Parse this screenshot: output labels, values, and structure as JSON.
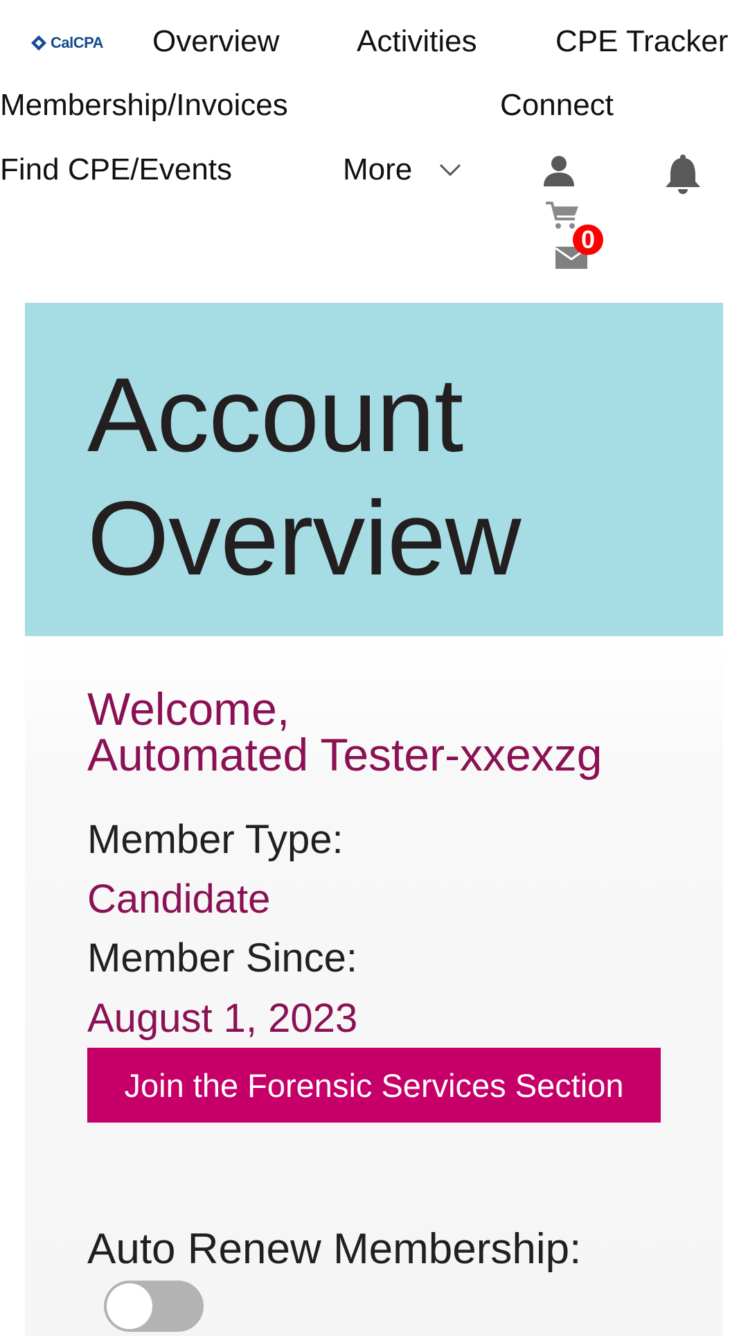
{
  "header": {
    "logo_text": "CalCPA",
    "nav": {
      "overview": "Overview",
      "activities": "Activities",
      "cpe_tracker": "CPE Tracker",
      "membership_invoices": "Membership/Invoices",
      "connect": "Connect",
      "find_cpe_events": "Find CPE/Events",
      "more": "More"
    },
    "icons": [
      "user-icon",
      "bell-icon",
      "cart-icon",
      "mail-icon",
      "chevron-down-icon"
    ],
    "cart_count": "0"
  },
  "hero": {
    "title": "Account Overview"
  },
  "account": {
    "welcome_line1": "Welcome,",
    "welcome_line2": "Automated Tester-xxexzg",
    "member_type_label": "Member Type:",
    "member_type_value": "Candidate",
    "member_since_label": "Member Since:",
    "member_since_value": "August 1, 2023",
    "join_button": "Join the Forensic Services Section",
    "auto_renew_label": "Auto Renew Membership:",
    "auto_renew_on": false
  },
  "colors": {
    "hero_bg": "#a6dce3",
    "accent_text": "#8b1154",
    "button_bg": "#c60068",
    "badge_bg": "#ff0000"
  }
}
